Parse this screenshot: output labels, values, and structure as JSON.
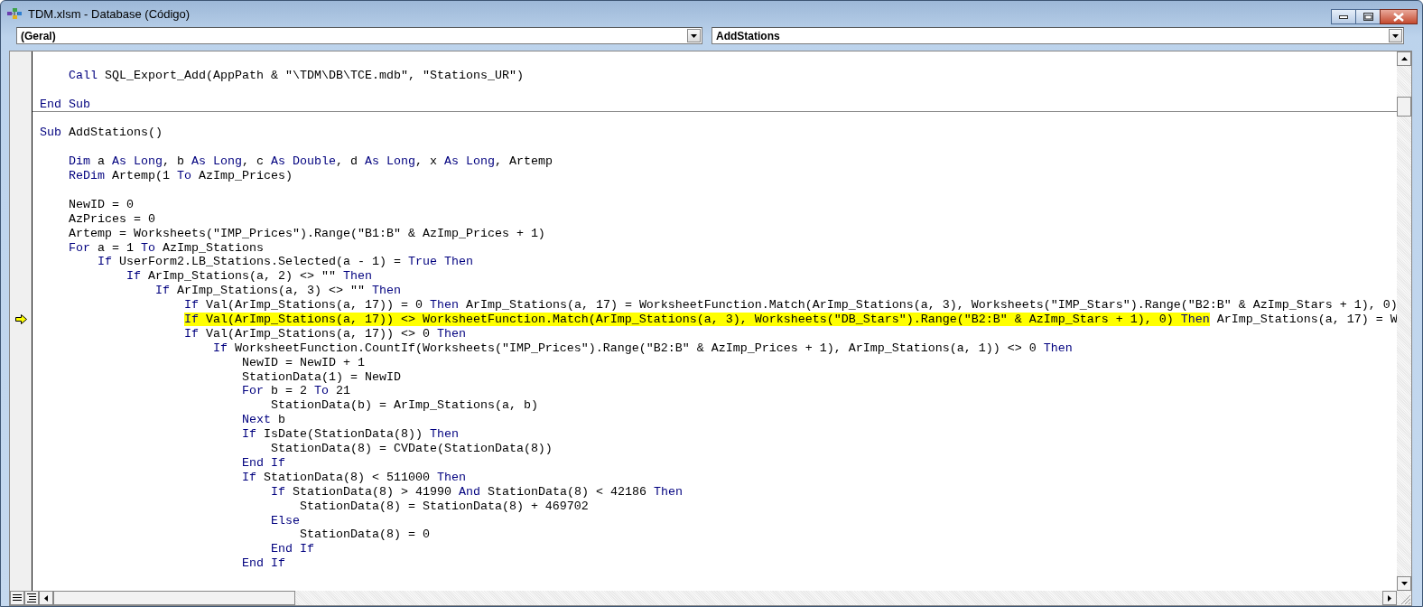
{
  "window": {
    "title": "TDM.xlsm - Database (Código)"
  },
  "object_combo": {
    "value": "(Geral)"
  },
  "procedure_combo": {
    "value": "AddStations"
  },
  "code_lines": [
    {
      "kind": "blank"
    },
    {
      "kind": "code",
      "segments": [
        {
          "kind": "keyword",
          "text": "    Call"
        },
        {
          "kind": "plain",
          "text": " SQL_Export_Add(AppPath & \"\\TDM\\DB\\TCE.mdb\", \"Stations_UR\")"
        }
      ]
    },
    {
      "kind": "blank"
    },
    {
      "kind": "code",
      "separator_after": true,
      "segments": [
        {
          "kind": "keyword",
          "text": "End Sub"
        }
      ]
    },
    {
      "kind": "blank"
    },
    {
      "kind": "code",
      "segments": [
        {
          "kind": "keyword",
          "text": "Sub"
        },
        {
          "kind": "plain",
          "text": " AddStations()"
        }
      ]
    },
    {
      "kind": "blank"
    },
    {
      "kind": "code",
      "segments": [
        {
          "kind": "keyword",
          "text": "    Dim"
        },
        {
          "kind": "plain",
          "text": " a "
        },
        {
          "kind": "keyword",
          "text": "As Long"
        },
        {
          "kind": "plain",
          "text": ", b "
        },
        {
          "kind": "keyword",
          "text": "As Long"
        },
        {
          "kind": "plain",
          "text": ", c "
        },
        {
          "kind": "keyword",
          "text": "As Double"
        },
        {
          "kind": "plain",
          "text": ", d "
        },
        {
          "kind": "keyword",
          "text": "As Long"
        },
        {
          "kind": "plain",
          "text": ", x "
        },
        {
          "kind": "keyword",
          "text": "As Long"
        },
        {
          "kind": "plain",
          "text": ", Artemp"
        }
      ]
    },
    {
      "kind": "code",
      "segments": [
        {
          "kind": "keyword",
          "text": "    ReDim"
        },
        {
          "kind": "plain",
          "text": " Artemp(1 "
        },
        {
          "kind": "keyword",
          "text": "To"
        },
        {
          "kind": "plain",
          "text": " AzImp_Prices)"
        }
      ]
    },
    {
      "kind": "blank"
    },
    {
      "kind": "code",
      "segments": [
        {
          "kind": "plain",
          "text": "    NewID = 0"
        }
      ]
    },
    {
      "kind": "code",
      "segments": [
        {
          "kind": "plain",
          "text": "    AzPrices = 0"
        }
      ]
    },
    {
      "kind": "code",
      "segments": [
        {
          "kind": "plain",
          "text": "    Artemp = Worksheets(\"IMP_Prices\").Range(\"B1:B\" & AzImp_Prices + 1)"
        }
      ]
    },
    {
      "kind": "code",
      "segments": [
        {
          "kind": "keyword",
          "text": "    For"
        },
        {
          "kind": "plain",
          "text": " a = 1 "
        },
        {
          "kind": "keyword",
          "text": "To"
        },
        {
          "kind": "plain",
          "text": " AzImp_Stations"
        }
      ]
    },
    {
      "kind": "code",
      "segments": [
        {
          "kind": "keyword",
          "text": "        If"
        },
        {
          "kind": "plain",
          "text": " UserForm2.LB_Stations.Selected(a - 1) = "
        },
        {
          "kind": "keyword",
          "text": "True Then"
        }
      ]
    },
    {
      "kind": "code",
      "segments": [
        {
          "kind": "keyword",
          "text": "            If"
        },
        {
          "kind": "plain",
          "text": " ArImp_Stations(a, 2) <> \"\" "
        },
        {
          "kind": "keyword",
          "text": "Then"
        }
      ]
    },
    {
      "kind": "code",
      "segments": [
        {
          "kind": "keyword",
          "text": "                If"
        },
        {
          "kind": "plain",
          "text": " ArImp_Stations(a, 3) <> \"\" "
        },
        {
          "kind": "keyword",
          "text": "Then"
        }
      ]
    },
    {
      "kind": "code",
      "segments": [
        {
          "kind": "keyword",
          "text": "                    If"
        },
        {
          "kind": "plain",
          "text": " Val(ArImp_Stations(a, 17)) = 0 "
        },
        {
          "kind": "keyword",
          "text": "Then"
        },
        {
          "kind": "plain",
          "text": " ArImp_Stations(a, 17) = WorksheetFunction.Match(ArImp_Stations(a, 3), Worksheets(\"IMP_Stars\").Range(\"B2:B\" & AzImp_Stars + 1), 0)"
        }
      ]
    },
    {
      "kind": "code",
      "execution_point": true,
      "segments": [
        {
          "kind": "keyword",
          "text": "                    If",
          "highlighted": true
        },
        {
          "kind": "plain",
          "text": " Val(ArImp_Stations(a, 17)) <> WorksheetFunction.Match(ArImp_Stations(a, 3), Worksheets(\"DB_Stars\").Range(\"B2:B\" & AzImp_Stars + 1), 0) ",
          "highlighted": true
        },
        {
          "kind": "keyword",
          "text": "Then",
          "highlighted": true
        },
        {
          "kind": "plain",
          "text": " ArImp_Stations(a, 17) = W"
        }
      ]
    },
    {
      "kind": "code",
      "segments": [
        {
          "kind": "keyword",
          "text": "                    If"
        },
        {
          "kind": "plain",
          "text": " Val(ArImp_Stations(a, 17)) <> 0 "
        },
        {
          "kind": "keyword",
          "text": "Then"
        }
      ]
    },
    {
      "kind": "code",
      "segments": [
        {
          "kind": "keyword",
          "text": "                        If"
        },
        {
          "kind": "plain",
          "text": " WorksheetFunction.CountIf(Worksheets(\"IMP_Prices\").Range(\"B2:B\" & AzImp_Prices + 1), ArImp_Stations(a, 1)) <> 0 "
        },
        {
          "kind": "keyword",
          "text": "Then"
        }
      ]
    },
    {
      "kind": "code",
      "segments": [
        {
          "kind": "plain",
          "text": "                            NewID = NewID + 1"
        }
      ]
    },
    {
      "kind": "code",
      "segments": [
        {
          "kind": "plain",
          "text": "                            StationData(1) = NewID"
        }
      ]
    },
    {
      "kind": "code",
      "segments": [
        {
          "kind": "keyword",
          "text": "                            For"
        },
        {
          "kind": "plain",
          "text": " b = 2 "
        },
        {
          "kind": "keyword",
          "text": "To"
        },
        {
          "kind": "plain",
          "text": " 21"
        }
      ]
    },
    {
      "kind": "code",
      "segments": [
        {
          "kind": "plain",
          "text": "                                StationData(b) = ArImp_Stations(a, b)"
        }
      ]
    },
    {
      "kind": "code",
      "segments": [
        {
          "kind": "keyword",
          "text": "                            Next"
        },
        {
          "kind": "plain",
          "text": " b"
        }
      ]
    },
    {
      "kind": "code",
      "segments": [
        {
          "kind": "keyword",
          "text": "                            If"
        },
        {
          "kind": "plain",
          "text": " IsDate(StationData(8)) "
        },
        {
          "kind": "keyword",
          "text": "Then"
        }
      ]
    },
    {
      "kind": "code",
      "segments": [
        {
          "kind": "plain",
          "text": "                                StationData(8) = CVDate(StationData(8))"
        }
      ]
    },
    {
      "kind": "code",
      "segments": [
        {
          "kind": "keyword",
          "text": "                            End If"
        }
      ]
    },
    {
      "kind": "code",
      "segments": [
        {
          "kind": "keyword",
          "text": "                            If"
        },
        {
          "kind": "plain",
          "text": " StationData(8) < 511000 "
        },
        {
          "kind": "keyword",
          "text": "Then"
        }
      ]
    },
    {
      "kind": "code",
      "segments": [
        {
          "kind": "keyword",
          "text": "                                If"
        },
        {
          "kind": "plain",
          "text": " StationData(8) > 41990 "
        },
        {
          "kind": "keyword",
          "text": "And"
        },
        {
          "kind": "plain",
          "text": " StationData(8) < 42186 "
        },
        {
          "kind": "keyword",
          "text": "Then"
        }
      ]
    },
    {
      "kind": "code",
      "segments": [
        {
          "kind": "plain",
          "text": "                                    StationData(8) = StationData(8) + 469702"
        }
      ]
    },
    {
      "kind": "code",
      "segments": [
        {
          "kind": "keyword",
          "text": "                                Else"
        }
      ]
    },
    {
      "kind": "code",
      "segments": [
        {
          "kind": "plain",
          "text": "                                    StationData(8) = 0"
        }
      ]
    },
    {
      "kind": "code",
      "segments": [
        {
          "kind": "keyword",
          "text": "                                End If"
        }
      ]
    },
    {
      "kind": "code",
      "segments": [
        {
          "kind": "keyword",
          "text": "                            End If"
        }
      ]
    }
  ]
}
